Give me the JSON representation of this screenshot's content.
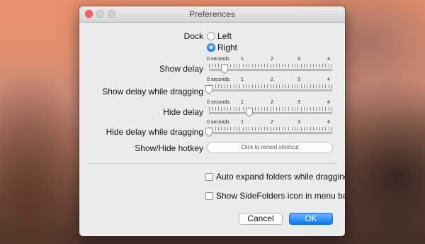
{
  "window": {
    "title": "Preferences"
  },
  "dock": {
    "label": "Dock",
    "options": [
      {
        "label": "Left",
        "selected": false
      },
      {
        "label": "Right",
        "selected": true
      }
    ]
  },
  "tick_labels": [
    "0 seconds",
    "1",
    "2",
    "3",
    "4"
  ],
  "sliders": [
    {
      "label": "Show delay",
      "value_seconds": 0.5,
      "max_seconds": 4
    },
    {
      "label": "Show delay while dragging",
      "value_seconds": 0,
      "max_seconds": 4
    },
    {
      "label": "Hide delay",
      "value_seconds": 1.3,
      "max_seconds": 4
    },
    {
      "label": "Hide delay while dragging",
      "value_seconds": 0,
      "max_seconds": 4
    }
  ],
  "hotkey": {
    "label": "Show/Hide hotkey",
    "placeholder": "Click to record shortcut"
  },
  "checkboxes": [
    {
      "label": "Auto expand folders while dragging",
      "checked": false
    },
    {
      "label": "Show SideFolders icon in menu bar",
      "checked": false
    }
  ],
  "buttons": {
    "cancel": "Cancel",
    "ok": "OK"
  },
  "colors": {
    "accent": "#167efb",
    "close": "#fc605c"
  }
}
